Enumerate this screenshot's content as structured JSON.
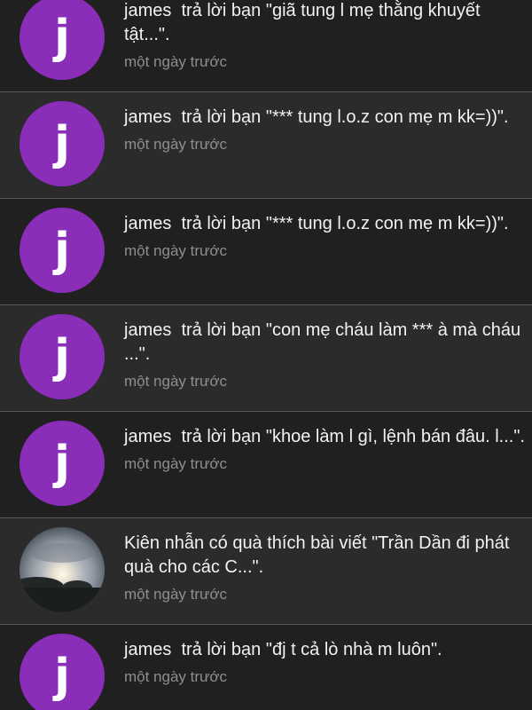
{
  "notifications": [
    {
      "avatar_letter": "j",
      "avatar_type": "letter",
      "message": "james  trả lời bạn \"giã tung l mẹ thằng khuyết tật...\".",
      "time": "một ngày trước"
    },
    {
      "avatar_letter": "j",
      "avatar_type": "letter",
      "message": "james  trả lời bạn \"*** tung l.o.z con mẹ m kk=))\".",
      "time": "một ngày trước"
    },
    {
      "avatar_letter": "j",
      "avatar_type": "letter",
      "message": "james  trả lời bạn \"*** tung l.o.z con mẹ m kk=))\".",
      "time": "một ngày trước"
    },
    {
      "avatar_letter": "j",
      "avatar_type": "letter",
      "message": "james  trả lời bạn \"con mẹ cháu làm *** à mà cháu ...\".",
      "time": "một ngày trước"
    },
    {
      "avatar_letter": "j",
      "avatar_type": "letter",
      "message": "james  trả lời bạn \"khoe làm l gì, lệnh bán đâu. l...\".",
      "time": "một ngày trước"
    },
    {
      "avatar_letter": "",
      "avatar_type": "photo",
      "message": "Kiên nhẫn có quà thích bài viết \"Trần Dần đi phát quà cho các C...\".",
      "time": "một ngày trước"
    },
    {
      "avatar_letter": "j",
      "avatar_type": "letter",
      "message": "james  trả lời bạn \"đj t cả lò nhà m luôn\".",
      "time": "một ngày trước"
    }
  ],
  "colors": {
    "avatar_purple": "#8a2db8",
    "row_dark": "#202021",
    "row_normal": "#2b2b2c",
    "text_primary": "#f2f2f2",
    "text_secondary": "#8e8e93"
  }
}
